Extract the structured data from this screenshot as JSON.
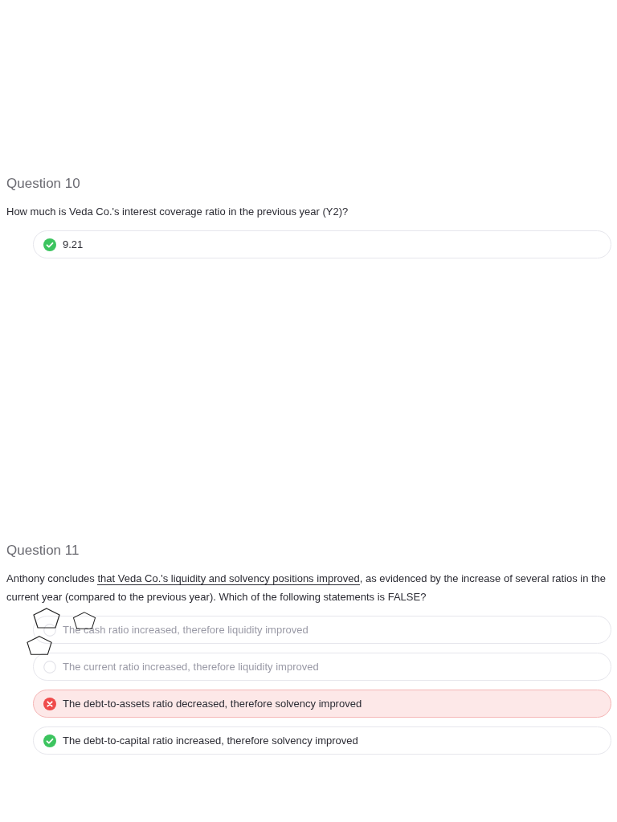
{
  "questions": [
    {
      "title": "Question 10",
      "text_segments": [
        {
          "text": "How much is Veda Co.'s interest coverage ratio in the previous year (Y2)?",
          "underlined": false
        }
      ],
      "answers": [
        {
          "text": "9.21",
          "kind": "correct"
        }
      ]
    },
    {
      "title": "Question 11",
      "text_segments": [
        {
          "text": "Anthony concludes ",
          "underlined": false
        },
        {
          "text": "that Veda Co.'s liquidity and solvency positions improved",
          "underlined": true
        },
        {
          "text": ", as evidenced by the increase of several ratios in the current year (compared to the previous year). Which of the following statements is FALSE?",
          "underlined": false
        }
      ],
      "answers": [
        {
          "text": "The cash ratio increased, therefore liquidity improved",
          "kind": "plain"
        },
        {
          "text": "The current ratio increased, therefore liquidity improved",
          "kind": "plain"
        },
        {
          "text": "The debt-to-assets ratio decreased, therefore solvency improved",
          "kind": "incorrect"
        },
        {
          "text": "The debt-to-capital ratio increased, therefore solvency improved",
          "kind": "correct"
        }
      ]
    }
  ]
}
